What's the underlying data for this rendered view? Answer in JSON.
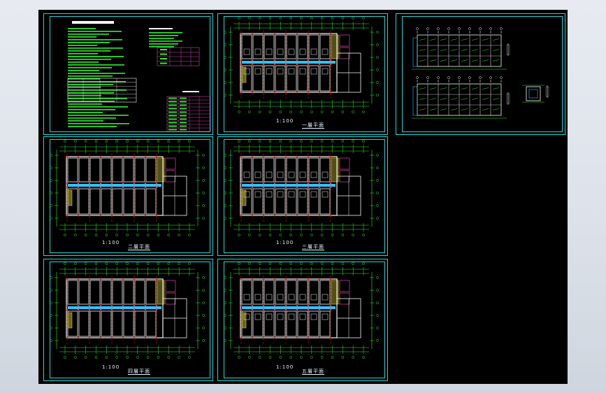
{
  "colors": {
    "viewport": "#000000",
    "frame": "#25d7d7",
    "wall": "#f4f4f4",
    "column": "#ff2a2a",
    "dimension": "#2ef02e",
    "partition": "#ff4fd0",
    "corridor": "#2cc4ff",
    "stairs": "#f4e22a"
  },
  "drawings": [
    {
      "name": "design-notes-sheet"
    },
    {
      "name": "floor-plan-sheet-1",
      "title": "一層平面",
      "scale": "1:100"
    },
    {
      "name": "elevation-detail-sheet"
    },
    {
      "name": "floor-plan-sheet-2",
      "title": "二層平面",
      "scale": "1:100"
    },
    {
      "name": "floor-plan-sheet-3",
      "title": "三層平面",
      "scale": "1:100"
    },
    {
      "name": "floor-plan-sheet-4",
      "title": "四層平面",
      "scale": "1:100"
    },
    {
      "name": "floor-plan-sheet-5",
      "title": "五層平面",
      "scale": "1:100"
    }
  ]
}
